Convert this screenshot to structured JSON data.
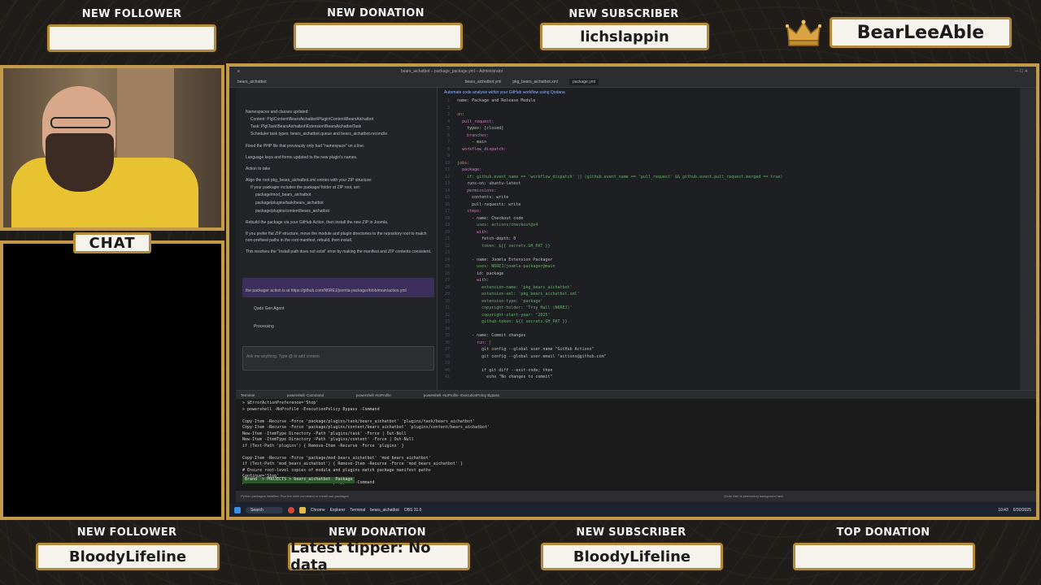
{
  "top_alerts": [
    {
      "label": "NEW FOLLOWER",
      "value": ""
    },
    {
      "label": "NEW DONATION",
      "value": ""
    },
    {
      "label": "NEW SUBSCRIBER",
      "value": "lichslappin"
    },
    {
      "label": "",
      "value": "BearLeeAble"
    }
  ],
  "bottom_alerts": [
    {
      "label": "NEW FOLLOWER",
      "value": "BloodyLifeline"
    },
    {
      "label": "NEW DONATION",
      "value": "Latest tipper: No data"
    },
    {
      "label": "NEW SUBSCRIBER",
      "value": "BloodyLifeline"
    },
    {
      "label": "TOP DONATION",
      "value": ""
    }
  ],
  "chat": {
    "title": "CHAT"
  },
  "ide": {
    "title": "bears_aichatbot – package_package.yml – Administrator",
    "project": "bears_aichatbot",
    "tabs": [
      "bears_aichatbot.yml",
      "pkg_bears_aichatbot.xml",
      "package.yml"
    ],
    "assistant_banner": "Automate code analysis within your GitHub workflow using Qodana",
    "assistant_lines": [
      "Namespaces and classes updated:",
      "Content: Plg\\Content\\BearsAichatbot\\Plugin\\Content\\BearsAichatbot",
      "Task: Plg\\Task\\BearsAichatbot\\Extension\\BearsAichatbotTask",
      "Scheduler task types: bears_aichatbot.queue and bears_aichatbot.reconcile",
      "Fixed the PHP file that previously only had \"namespace\" on a line.",
      "Language keys and forms updated to the new plugin's names.",
      "Action to take",
      "Align the root pkg_bears_aichatbot.xml entries with your ZIP structure:",
      "If your packager includes the package/ folder at ZIP root, set:",
      "package/mod_bears_aichatbot",
      "package/plugins/task/bears_aichatbot",
      "package/plugins/content/bears_aichatbot",
      "Rebuild the package via your GitHub Action, then install the new ZIP in Joomla.",
      "If you prefer flat ZIP structure, move the module and plugin directories to the repository root to match non-prefixed paths in the root manifest, rebuild, then install.",
      "This resolves the \"Install path does not exist\" error by making the manifest and ZIP contents consistent."
    ],
    "user_message": "the packager action is at https://github.com/N6REJ/joomla-packager/blob/main/action.yml",
    "agent_label": "Qodo Gen Agent",
    "processing": "Processing",
    "input_placeholder": "Ask me anything. Type @ to add context",
    "terminal_tabs": [
      "Terminal",
      "powershell -Command",
      "powershell -NoProfile",
      "powershell -NoProfile -ExecutionPolicy Bypass"
    ],
    "terminal_lines": [
      "> $ErrorActionPreference='Stop'",
      "> powershell -NoProfile -ExecutionPolicy Bypass -Command",
      "",
      "Copy-Item -Recurse -Force 'package/plugins/task/bears_aichatbot' 'plugins/task/bears_aichatbot'",
      "Copy-Item -Recurse -Force 'package/plugins/content/bears_aichatbot' 'plugins/content/bears_aichatbot'",
      "New-Item -ItemType Directory -Path 'plugins/task' -Force | Out-Null",
      "New-Item -ItemType Directory -Path 'plugins/content' -Force | Out-Null",
      "if (Test-Path 'plugins') { Remove-Item -Recurse -Force 'plugins' }",
      "",
      "Copy-Item -Recurse -Force 'package/mod_bears_aichatbot' 'mod_bears_aichatbot'",
      "if (Test-Path 'mod_bears_aichatbot') { Remove-Item -Recurse -Force 'mod_bears_aichatbot' }",
      "# Ensure root-level copies of module and plugins match package manifest paths",
      "Continue='Stop'",
      "powershell -NoProfile -ExecutionPolicy Bypass -Command"
    ],
    "prompt": "Brand  > PROJECTS > bears_aichatbot  Package",
    "code_lines": [
      [
        "name: Package and Release Module",
        "plain"
      ],
      [
        "",
        "plain"
      ],
      [
        "on:",
        "kw"
      ],
      [
        "  pull_request:",
        "key"
      ],
      [
        "    types: [closed]",
        "plain"
      ],
      [
        "    branches:",
        "key"
      ],
      [
        "      - main",
        "plain"
      ],
      [
        "  workflow_dispatch:",
        "key"
      ],
      [
        "",
        "plain"
      ],
      [
        "jobs:",
        "kw"
      ],
      [
        "  package:",
        "key"
      ],
      [
        "    if: github.event_name == 'workflow_dispatch' || (github.event_name == 'pull_request' && github.event.pull_request.merged == true)",
        "str"
      ],
      [
        "    runs-on: ubuntu-latest",
        "plain"
      ],
      [
        "    permissions:",
        "key"
      ],
      [
        "      contents: write",
        "plain"
      ],
      [
        "      pull-requests: write",
        "plain"
      ],
      [
        "    steps:",
        "key"
      ],
      [
        "      - name: Checkout code",
        "plain"
      ],
      [
        "        uses: actions/checkout@v4",
        "str"
      ],
      [
        "        with:",
        "key"
      ],
      [
        "          fetch-depth: 0",
        "plain"
      ],
      [
        "          token: ${{ secrets.GH_PAT }}",
        "str"
      ],
      [
        "",
        "plain"
      ],
      [
        "      - name: Joomla Extension Packager",
        "plain"
      ],
      [
        "        uses: N6REJ/joomla-packager@main",
        "str"
      ],
      [
        "        id: package",
        "plain"
      ],
      [
        "        with:",
        "key"
      ],
      [
        "          extension-name: 'pkg_bears_aichatbot'",
        "str"
      ],
      [
        "          extension-xml: 'pkg_bears_aichatbot.xml'",
        "str"
      ],
      [
        "          extension-type: 'package'",
        "str"
      ],
      [
        "          copyright-holder: 'Troy Hall (N6REJ)'",
        "str"
      ],
      [
        "          copyright-start-year: '2025'",
        "str"
      ],
      [
        "          github-token: ${{ secrets.GH_PAT }}",
        "str"
      ],
      [
        "",
        "plain"
      ],
      [
        "      - name: Commit changes",
        "plain"
      ],
      [
        "        run: |",
        "key"
      ],
      [
        "          git config --global user.name \"GitHub Actions\"",
        "plain"
      ],
      [
        "          git config --global user.email \"actions@github.com\"",
        "plain"
      ],
      [
        "",
        "plain"
      ],
      [
        "          if git diff --exit-code; then",
        "plain"
      ],
      [
        "            echo \"No changes to commit\"",
        "plain"
      ]
    ],
    "status_left": "Python packages installed. Run the shell command or install sub-packages",
    "status_right": "Qodo Gen is performing background task",
    "taskbar": {
      "search": "Search",
      "clock": "10:43",
      "date": "6/30/2025"
    },
    "taskbar_apps": [
      "Chrome",
      "Explorer",
      "Terminal",
      "bears_aichatbot",
      "OBS 31.0"
    ]
  }
}
